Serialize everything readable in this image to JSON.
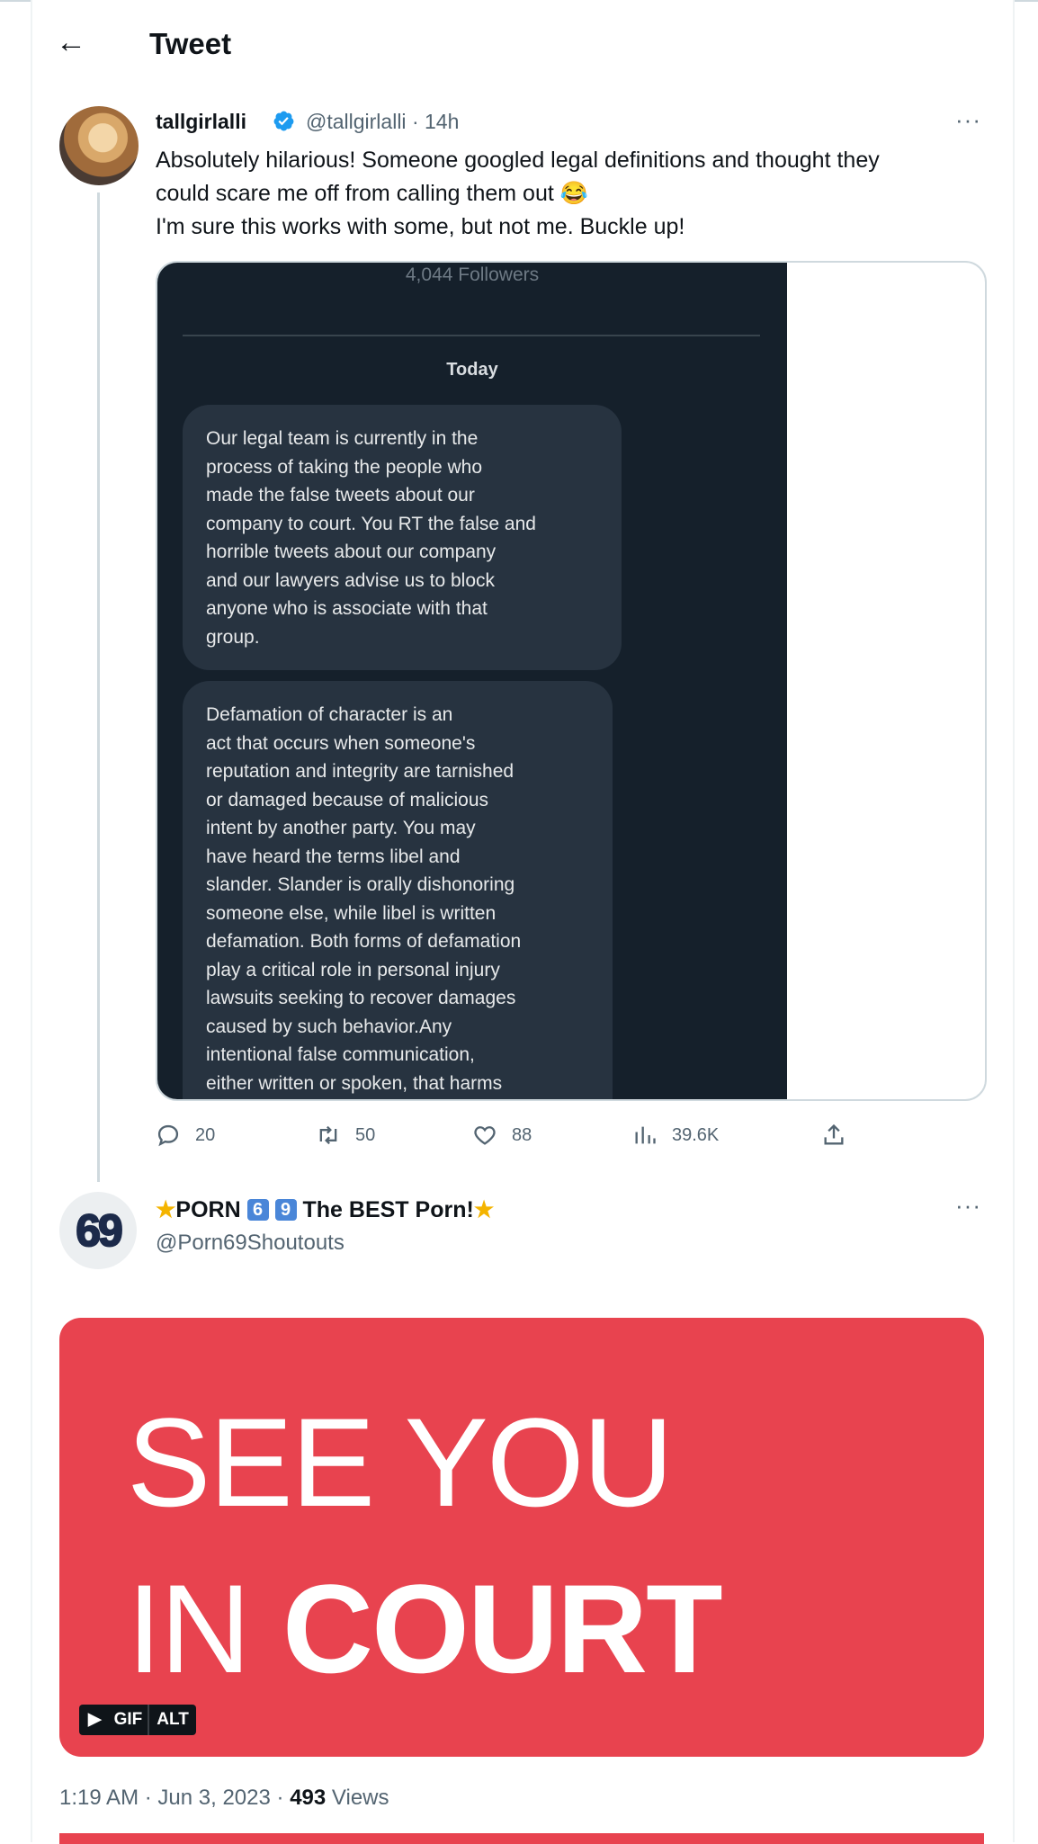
{
  "header": {
    "title": "Tweet",
    "back_icon": "arrow-left-icon"
  },
  "tweet": {
    "display_name": "tallgirlalli",
    "handle": "@tallgirlalli",
    "separator": "·",
    "time_ago": "14h",
    "verified_color": "#1d9bf0",
    "text_lines": [
      "Absolutely hilarious! Someone googled legal definitions and thought they",
      "could scare me off from calling them out 😂",
      "I'm sure this works with some, but not me. Buckle up!"
    ],
    "media": {
      "followers": "4,044 Followers",
      "day_label": "Today",
      "message1_lines": [
        "Our legal team is currently in the",
        "process of taking the people who",
        "made the false tweets about our",
        "company to court. You RT the false and",
        "horrible tweets about our company",
        "and our lawyers advise us to block",
        "anyone who is associate with that",
        "group."
      ],
      "message2_lines": [
        "Defamation of character is an",
        "act that occurs when someone's",
        "reputation and integrity are tarnished",
        "or damaged because of malicious",
        "intent by another party. You may",
        "have heard the terms libel and",
        "slander. Slander is orally dishonoring",
        "someone else, while libel is written",
        "defamation. Both forms of defamation",
        "play a critical role in personal injury",
        "lawsuits seeking to recover damages",
        "caused by such behavior.Any",
        "intentional false communication,",
        "either written or spoken, that harms"
      ]
    },
    "actions": {
      "replies": "20",
      "retweets": "50",
      "likes": "88",
      "views": "39.6K"
    }
  },
  "reply": {
    "avatar_text": "69",
    "name_prefix": "PORN",
    "name_digit1": "6",
    "name_digit2": "9",
    "name_suffix": "The BEST Porn!",
    "handle": "@Porn69Shoutouts",
    "gif": {
      "line1": "SEE YOU",
      "line2_plain": "IN",
      "line2_bold": "COURT",
      "badge_gif": "GIF",
      "badge_alt": "ALT",
      "background": "#e8434f"
    },
    "meta": {
      "time": "1:19 AM",
      "separator": "·",
      "date": "Jun 3, 2023",
      "views_count": "493",
      "views_label": "Views"
    }
  }
}
